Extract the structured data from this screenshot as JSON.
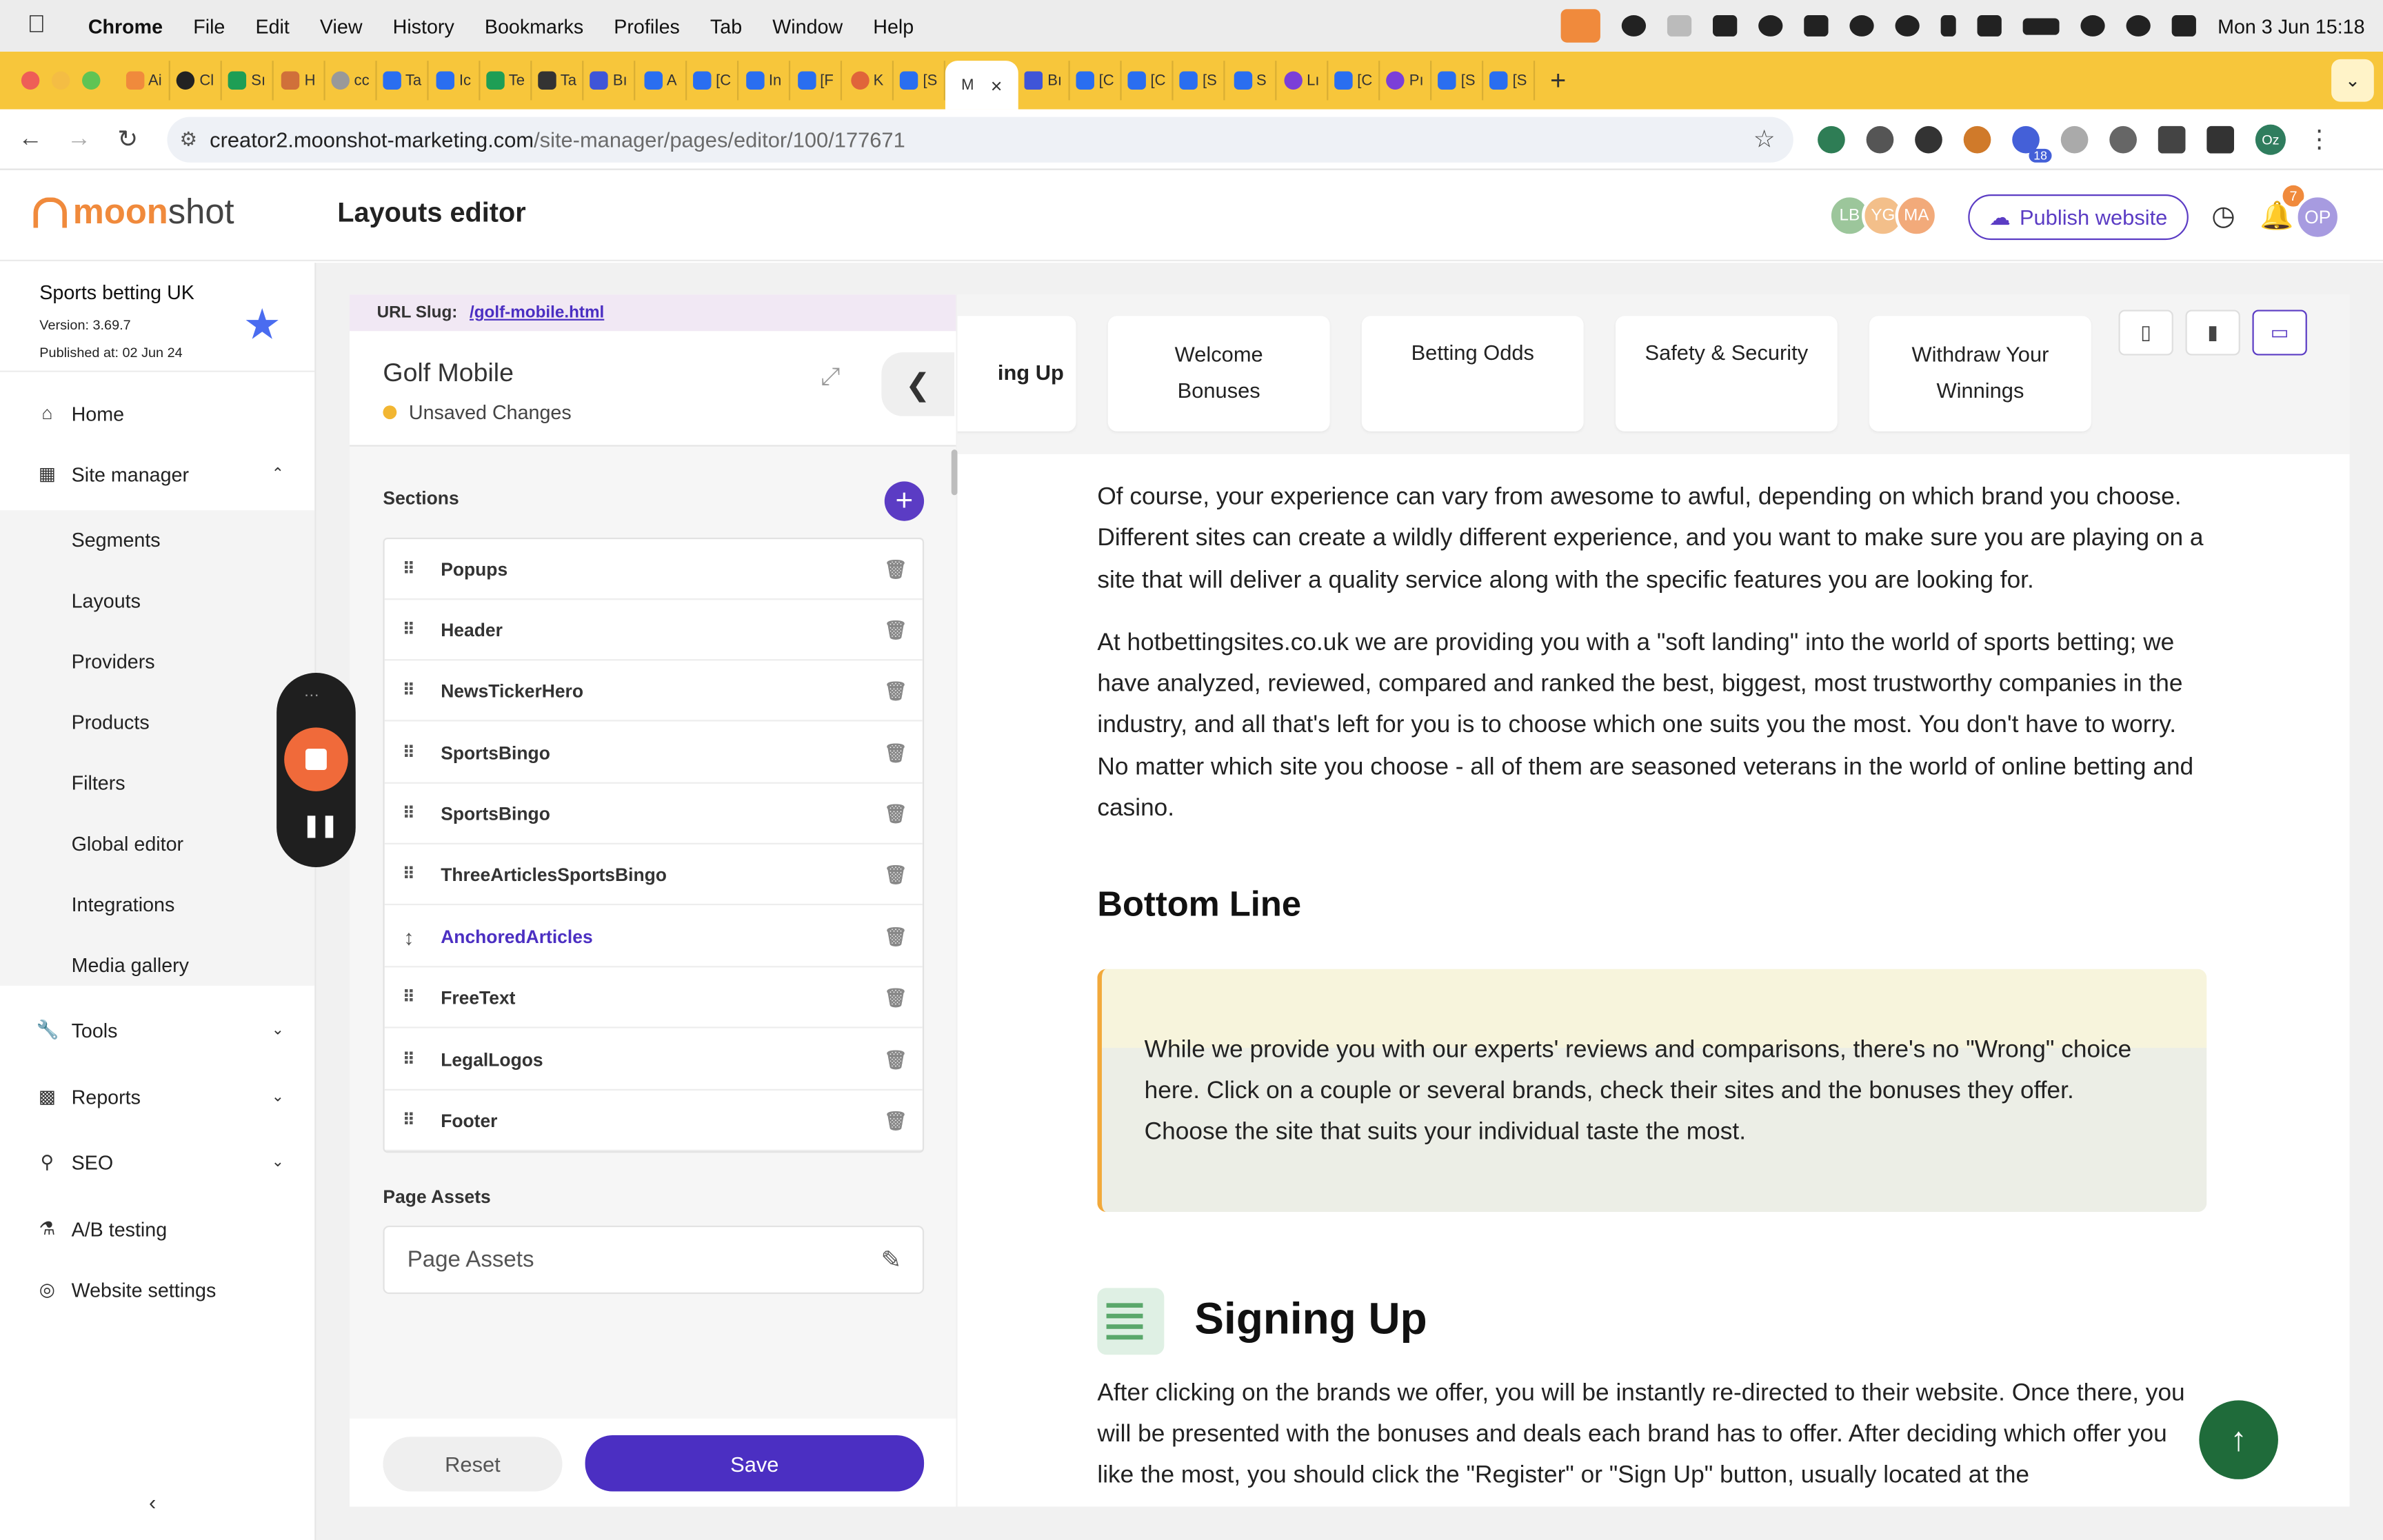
{
  "menubar": {
    "app": "Chrome",
    "items": [
      "File",
      "Edit",
      "View",
      "History",
      "Bookmarks",
      "Profiles",
      "Tab",
      "Window",
      "Help"
    ],
    "clock": "Mon 3 Jun  15:18"
  },
  "tabs": {
    "items": [
      "Ai",
      "Cl",
      "Sı",
      "H",
      "cc",
      "Ta",
      "Ic",
      "Te",
      "Ta",
      "Bı",
      "A",
      "[C",
      "In",
      "[F",
      "K",
      "[S",
      "M",
      "Bı",
      "[C",
      "[C",
      "[S",
      "S",
      "Lı",
      "[C",
      "Pı",
      "[S",
      "[S"
    ],
    "active_index": 16,
    "close": "×",
    "new_tab": "+"
  },
  "address": {
    "host": "creator2.moonshot-marketing.com",
    "path": "/site-manager/pages/editor/100/177671",
    "extension_badge": "18",
    "profile_initials": "Oz"
  },
  "header": {
    "logo_moon": "moon",
    "logo_shot": "shot",
    "title": "Layouts editor",
    "avatars": [
      {
        "initials": "LB",
        "color": "#9cc69b"
      },
      {
        "initials": "YG",
        "color": "#f3bf8a"
      },
      {
        "initials": "MA",
        "color": "#f2aa7a"
      }
    ],
    "publish_label": "Publish website",
    "notification_count": "7",
    "user_initials": "OP",
    "user_color": "#a79be0"
  },
  "site": {
    "name": "Sports betting UK",
    "version": "Version: 3.69.7",
    "published": "Published at: 02 Jun 24"
  },
  "nav": {
    "home": "Home",
    "site_manager": "Site manager",
    "sub_items": [
      "Segments",
      "Layouts",
      "Providers",
      "Products",
      "Filters",
      "Global editor",
      "Integrations",
      "Media gallery"
    ],
    "tools": "Tools",
    "reports": "Reports",
    "seo": "SEO",
    "ab_testing": "A/B testing",
    "website_settings": "Website settings"
  },
  "panel": {
    "slug_label": "URL Slug:",
    "slug_value": "/golf-mobile.html",
    "title": "Golf Mobile",
    "status": "Unsaved Changes",
    "sections_label": "Sections",
    "sections": [
      "Popups",
      "Header",
      "NewsTickerHero",
      "SportsBingo",
      "SportsBingo",
      "ThreeArticlesSportsBingo",
      "AnchoredArticles",
      "FreeText",
      "LegalLogos",
      "Footer"
    ],
    "dragging_index": 6,
    "page_assets_label": "Page Assets",
    "page_assets_field": "Page Assets",
    "reset_label": "Reset",
    "save_label": "Save"
  },
  "preview": {
    "tabs": [
      "ing Up",
      "Welcome Bonuses",
      "Betting Odds",
      "Safety & Security",
      "Withdraw Your Winnings"
    ],
    "paragraph1": "Of course, your experience can vary from awesome to awful, depending on which brand you choose. Different sites can create a wildly different experience, and you want to make sure you are playing on a site that will deliver a quality service along with the specific features you are looking for.",
    "paragraph2": "At hotbettingsites.co.uk we are providing you with a \"soft landing\" into the world of sports betting; we have analyzed, reviewed, compared and ranked the best, biggest, most trustworthy companies in the industry, and all that's left for you is to choose which one suits you the most. You don't have to worry. No matter which site you choose - all of them are seasoned veterans in the world of online betting and casino.",
    "heading_bottom": "Bottom Line",
    "callout": "While we provide you with our experts' reviews and comparisons, there's no \"Wrong\" choice here. Click on a couple or several brands, check their sites and the bonuses they offer. Choose the site that suits your individual taste the most.",
    "heading_signing": "Signing Up",
    "paragraph3": "After clicking on the brands we offer, you will be instantly re-directed to their website. Once there, you will be presented with the bonuses and deals each brand has to offer. After deciding which offer you like the most, you should click the \"Register\" or \"Sign Up\" button, usually located at the"
  },
  "colors": {
    "brand_orange": "#f08a3c",
    "accent_purple": "#4b2fc2",
    "tabstrip": "#f7c63b",
    "scrolltop_green": "#1f6b3a"
  }
}
